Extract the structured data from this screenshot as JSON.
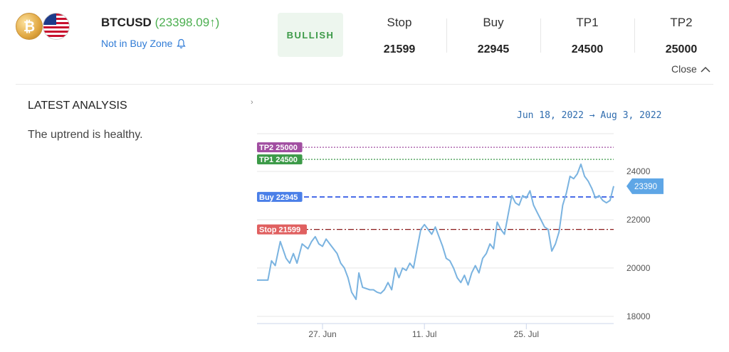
{
  "header": {
    "symbol": "BTCUSD",
    "price": "(23398.09↑)",
    "zone_status": "Not in Buy Zone",
    "sentiment": "BULLISH",
    "close_label": "Close"
  },
  "levels": [
    {
      "label": "Stop",
      "value": "21599"
    },
    {
      "label": "Buy",
      "value": "22945"
    },
    {
      "label": "TP1",
      "value": "24500"
    },
    {
      "label": "TP2",
      "value": "25000"
    }
  ],
  "analysis": {
    "title": "LATEST ANALYSIS",
    "text": "The uptrend is healthy."
  },
  "date_range": "Jun 18, 2022  →  Aug 3, 2022",
  "colors": {
    "price_line": "#7ab3e0",
    "tp2": "#a14ea1",
    "tp1": "#3c9a48",
    "buy": "#3f63e6",
    "stop": "#8b1a1a",
    "bullish": "#3c9a48"
  },
  "chart_data": {
    "type": "line",
    "ylim": [
      17700,
      25800
    ],
    "yticks": [
      "24000",
      "22000",
      "20000",
      "18000"
    ],
    "xticks": [
      {
        "label": "27. Jun",
        "day": 9
      },
      {
        "label": "11. Jul",
        "day": 23
      },
      {
        "label": "25. Jul",
        "day": 37
      }
    ],
    "last_price_label": "23390",
    "levels": [
      {
        "label": "TP2 25000",
        "value": 25000,
        "key": "tp2"
      },
      {
        "label": "TP1 24500",
        "value": 24500,
        "key": "tp1"
      },
      {
        "label": "Buy 22945",
        "value": 22945,
        "key": "buy"
      },
      {
        "label": "Stop 21599",
        "value": 21599,
        "key": "stop"
      }
    ],
    "x_end": 46,
    "series": [
      {
        "values": [
          [
            0,
            19500
          ],
          [
            1.5,
            19500
          ],
          [
            2,
            20300
          ],
          [
            2.5,
            20100
          ],
          [
            3.2,
            21100
          ],
          [
            4,
            20400
          ],
          [
            4.5,
            20200
          ],
          [
            5,
            20600
          ],
          [
            5.5,
            20200
          ],
          [
            6.2,
            21000
          ],
          [
            7,
            20800
          ],
          [
            7.5,
            21100
          ],
          [
            8,
            21300
          ],
          [
            8.5,
            21000
          ],
          [
            9,
            20900
          ],
          [
            9.5,
            21200
          ],
          [
            10,
            21000
          ],
          [
            11,
            20600
          ],
          [
            11.5,
            20200
          ],
          [
            12,
            20000
          ],
          [
            12.5,
            19600
          ],
          [
            13,
            19000
          ],
          [
            13.6,
            18700
          ],
          [
            14,
            19800
          ],
          [
            14.5,
            19200
          ],
          [
            15.5,
            19100
          ],
          [
            16,
            19100
          ],
          [
            16.5,
            19000
          ],
          [
            17,
            18950
          ],
          [
            17.5,
            19100
          ],
          [
            18,
            19400
          ],
          [
            18.5,
            19100
          ],
          [
            19,
            20000
          ],
          [
            19.5,
            19600
          ],
          [
            20,
            20000
          ],
          [
            20.5,
            19900
          ],
          [
            21,
            20200
          ],
          [
            21.5,
            20000
          ],
          [
            22,
            20800
          ],
          [
            22.5,
            21600
          ],
          [
            23,
            21800
          ],
          [
            23.5,
            21600
          ],
          [
            24,
            21400
          ],
          [
            24.5,
            21700
          ],
          [
            25,
            21300
          ],
          [
            25.5,
            20900
          ],
          [
            26,
            20400
          ],
          [
            26.5,
            20300
          ],
          [
            27,
            20000
          ],
          [
            27.5,
            19600
          ],
          [
            28,
            19400
          ],
          [
            28.5,
            19700
          ],
          [
            29,
            19300
          ],
          [
            29.5,
            19800
          ],
          [
            30,
            20100
          ],
          [
            30.5,
            19800
          ],
          [
            31,
            20400
          ],
          [
            31.5,
            20600
          ],
          [
            32,
            21000
          ],
          [
            32.5,
            20800
          ],
          [
            33,
            21900
          ],
          [
            33.5,
            21600
          ],
          [
            34,
            21400
          ],
          [
            34.5,
            22200
          ],
          [
            35,
            23000
          ],
          [
            35.5,
            22700
          ],
          [
            36,
            22600
          ],
          [
            36.5,
            23000
          ],
          [
            37,
            22900
          ],
          [
            37.5,
            23200
          ],
          [
            38,
            22600
          ],
          [
            38.5,
            22300
          ],
          [
            39,
            22000
          ],
          [
            39.5,
            21700
          ],
          [
            40,
            21600
          ],
          [
            40.5,
            20700
          ],
          [
            41,
            21000
          ],
          [
            41.5,
            21500
          ],
          [
            42,
            22600
          ],
          [
            42.5,
            23100
          ],
          [
            43,
            23800
          ],
          [
            43.5,
            23700
          ],
          [
            44,
            23900
          ],
          [
            44.5,
            24300
          ],
          [
            45,
            23800
          ],
          [
            45.5,
            23600
          ],
          [
            46,
            23300
          ],
          [
            46.5,
            22900
          ],
          [
            47,
            23000
          ],
          [
            47.5,
            22800
          ],
          [
            48,
            22700
          ],
          [
            48.5,
            22800
          ],
          [
            49,
            23390
          ]
        ]
      }
    ],
    "x_domain": [
      0,
      49
    ]
  }
}
